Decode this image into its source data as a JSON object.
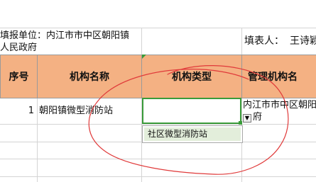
{
  "info_row": {
    "unit_label_line1": "填报单位：内江市市中区朝阳镇",
    "unit_label_line2": "人民政府",
    "filler_label": "填表人：",
    "filler_name": "王诗颖"
  },
  "headers": [
    "序号",
    "机构名称",
    "机构类型",
    "管理机构名"
  ],
  "rows": [
    {
      "index": "1",
      "name": "朝阳镇微型消防站",
      "type": "",
      "mgmt_line1": "内江市市中区朝阳",
      "mgmt_line2": "府"
    }
  ],
  "dropdown": {
    "options": [
      "社区微型消防站"
    ]
  },
  "colors": {
    "header_fill": "#f4b183",
    "selection": "#3a9b3a",
    "annotation_ink": "#e03a3a",
    "dropdown_highlight": "#e3eedb"
  }
}
